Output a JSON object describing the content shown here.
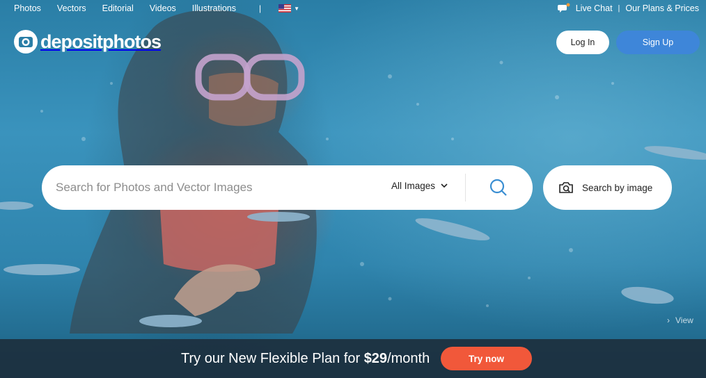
{
  "nav": {
    "items": [
      "Photos",
      "Vectors",
      "Editorial",
      "Videos",
      "Illustrations"
    ],
    "separator": "|",
    "language_flag": "us-flag-icon"
  },
  "top_right": {
    "live_chat": "Live Chat",
    "separator": "|",
    "plans": "Our Plans & Prices"
  },
  "logo": {
    "text": "depositphotos",
    "icon": "camera-logo-icon"
  },
  "auth": {
    "login": "Log In",
    "signup": "Sign Up"
  },
  "search": {
    "placeholder": "Search for Photos and Vector Images",
    "value": "",
    "type_selected": "All Images",
    "search_icon": "search-icon",
    "by_image": "Search by image"
  },
  "view": "View",
  "promo": {
    "text_before": "Try our New Flexible Plan for ",
    "price": "$29",
    "text_after": "/month",
    "cta": "Try now"
  },
  "colors": {
    "signup": "#3e86d9",
    "cta": "#f1583a",
    "promo_bar": "#1c2c3a"
  }
}
